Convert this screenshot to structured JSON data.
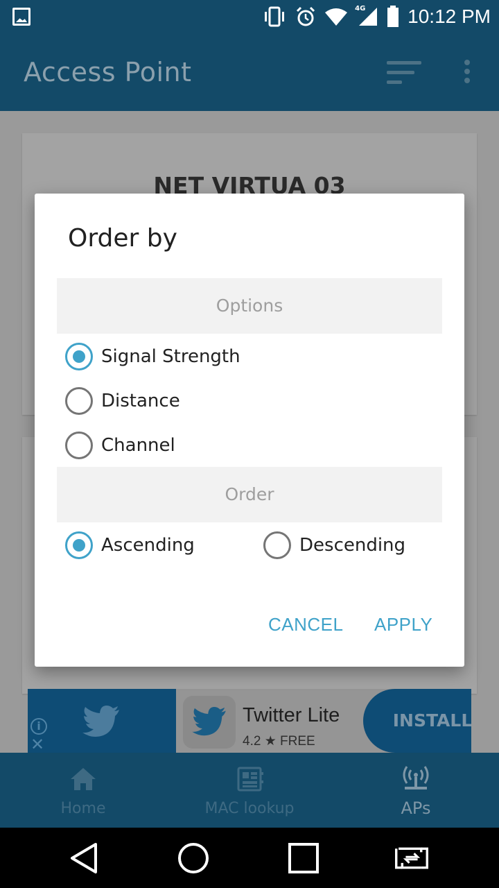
{
  "status_bar": {
    "time": "10:12 PM",
    "network_label": "4G",
    "icons": [
      "image-icon",
      "vibrate-icon",
      "alarm-icon",
      "wifi-icon",
      "signal-icon",
      "battery-icon"
    ]
  },
  "app_bar": {
    "title": "Access Point",
    "icons": [
      "sort-icon",
      "more-vert-icon"
    ]
  },
  "background": {
    "card_title": "NET VIRTUA 03"
  },
  "dialog": {
    "title": "Order by",
    "options_header": "Options",
    "options": [
      {
        "label": "Signal Strength",
        "checked": true
      },
      {
        "label": "Distance",
        "checked": false
      },
      {
        "label": "Channel",
        "checked": false
      }
    ],
    "order_header": "Order",
    "order": [
      {
        "label": "Ascending",
        "checked": true
      },
      {
        "label": "Descending",
        "checked": false
      }
    ],
    "cancel_label": "CANCEL",
    "apply_label": "APPLY",
    "accent_color": "#3fa2c9"
  },
  "ad": {
    "app_name": "Twitter Lite",
    "rating": "4.2",
    "star": "★",
    "price": "FREE",
    "install_label": "INSTALL",
    "info_glyph": "i",
    "close_glyph": "✕"
  },
  "bottom_nav": {
    "items": [
      {
        "label": "Home",
        "icon": "home-icon"
      },
      {
        "label": "MAC lookup",
        "icon": "chip-icon"
      },
      {
        "label": "APs",
        "icon": "router-icon",
        "active": true
      }
    ]
  },
  "system_nav": {
    "icons": [
      "back-icon",
      "home-circle-icon",
      "recents-icon",
      "switch-icon"
    ]
  },
  "colors": {
    "app_bar": "#134a68",
    "accent": "#3fa2c9"
  }
}
